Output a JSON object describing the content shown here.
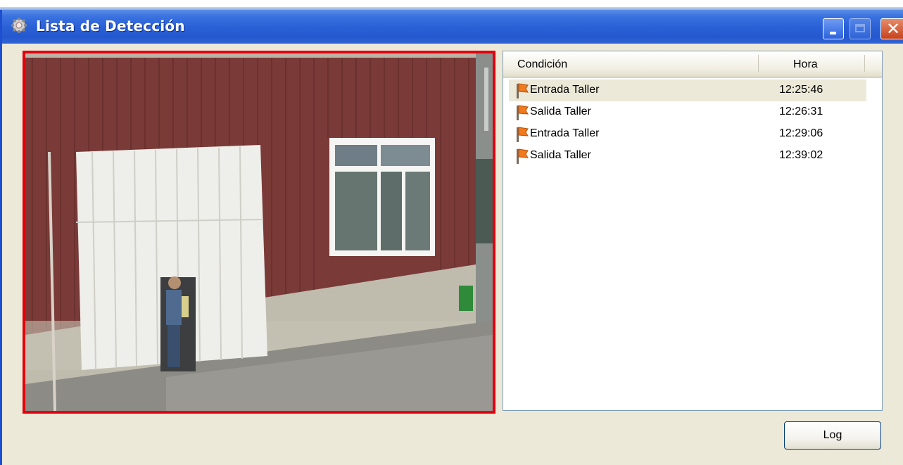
{
  "window": {
    "title": "Lista de Detección",
    "icon": "gear-app-icon",
    "controls": {
      "minimize": "minimize-icon",
      "maximize": "maximize-icon",
      "close": "✕"
    }
  },
  "colors": {
    "titlebar": "#2458cf",
    "video_border": "#e3000b",
    "flag": "#f07a1c"
  },
  "video": {
    "icon": "camera-feed"
  },
  "detection_list": {
    "columns": [
      "Condición",
      "Hora"
    ],
    "rows": [
      {
        "condition": "Entrada Taller",
        "time": "12:25:46",
        "selected": true
      },
      {
        "condition": "Salida Taller",
        "time": "12:26:31",
        "selected": false
      },
      {
        "condition": "Entrada Taller",
        "time": "12:29:06",
        "selected": false
      },
      {
        "condition": "Salida Taller",
        "time": "12:39:02",
        "selected": false
      }
    ]
  },
  "buttons": {
    "log_label": "Log"
  }
}
